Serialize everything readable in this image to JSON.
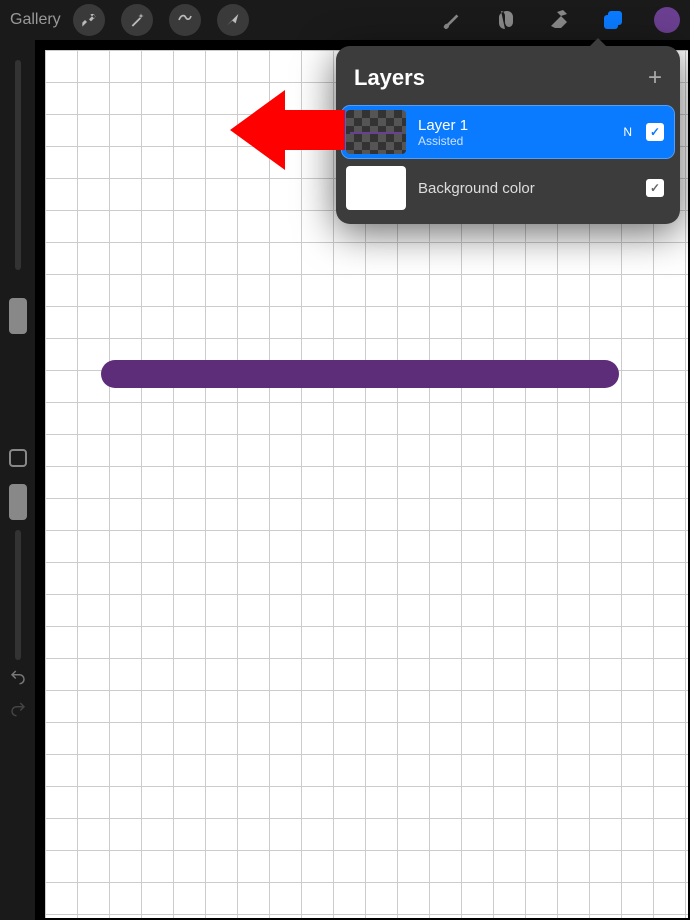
{
  "toolbar": {
    "gallery_label": "Gallery"
  },
  "layers_panel": {
    "title": "Layers",
    "layers": [
      {
        "name": "Layer 1",
        "subtext": "Assisted",
        "badge": "N",
        "selected": true,
        "visible": true
      },
      {
        "name": "Background color",
        "subtext": "",
        "badge": "",
        "selected": false,
        "visible": true
      }
    ]
  },
  "colors": {
    "current": "#6b3f91",
    "selection": "#0a7aff",
    "stroke": "#5e2d7a"
  },
  "icons": {
    "wrench": "wrench",
    "wand": "wand",
    "select": "select",
    "move": "move",
    "brush": "brush",
    "smudge": "smudge",
    "eraser": "eraser",
    "layers": "layers",
    "color": "color"
  }
}
